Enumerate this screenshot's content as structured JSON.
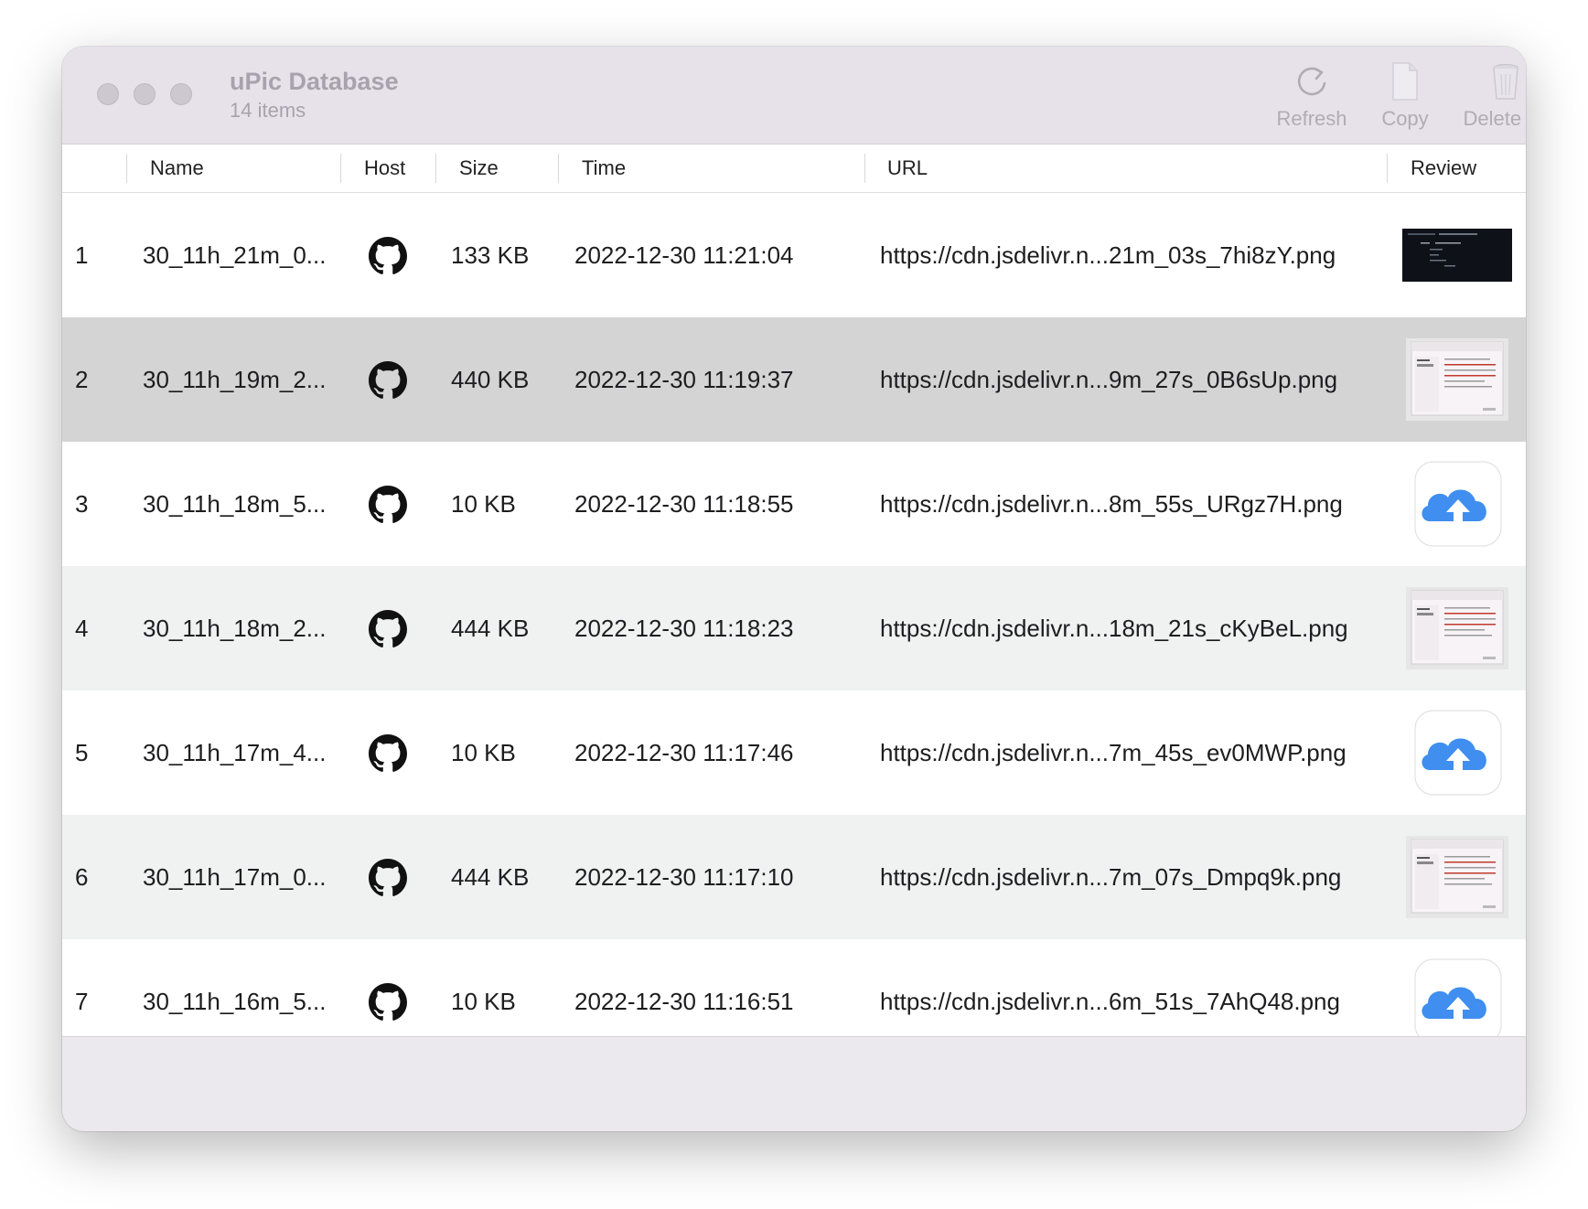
{
  "window": {
    "title": "uPic Database",
    "subtitle": "14 items"
  },
  "toolbar": {
    "refresh_label": "Refresh",
    "copy_label": "Copy",
    "delete_all_label": "Delete All"
  },
  "table": {
    "headers": {
      "index": "",
      "name": "Name",
      "host": "Host",
      "size": "Size",
      "time": "Time",
      "url": "URL",
      "review": "Review"
    },
    "rows": [
      {
        "index": "1",
        "name": "30_11h_21m_0...",
        "host_icon": "github-icon",
        "size": "133 KB",
        "time": "2022-12-30 11:21:04",
        "url": "https://cdn.jsdelivr.n...21m_03s_7hi8zY.png",
        "review": "dark-screenshot-thumbnail"
      },
      {
        "index": "2",
        "name": "30_11h_19m_2...",
        "host_icon": "github-icon",
        "size": "440 KB",
        "time": "2022-12-30 11:19:37",
        "url": "https://cdn.jsdelivr.n...9m_27s_0B6sUp.png",
        "review": "light-screenshot-thumbnail"
      },
      {
        "index": "3",
        "name": "30_11h_18m_5...",
        "host_icon": "github-icon",
        "size": "10 KB",
        "time": "2022-12-30 11:18:55",
        "url": "https://cdn.jsdelivr.n...8m_55s_URgz7H.png",
        "review": "upic-app-icon-thumbnail"
      },
      {
        "index": "4",
        "name": "30_11h_18m_2...",
        "host_icon": "github-icon",
        "size": "444 KB",
        "time": "2022-12-30 11:18:23",
        "url": "https://cdn.jsdelivr.n...18m_21s_cKyBeL.png",
        "review": "light-screenshot-thumbnail"
      },
      {
        "index": "5",
        "name": "30_11h_17m_4...",
        "host_icon": "github-icon",
        "size": "10 KB",
        "time": "2022-12-30 11:17:46",
        "url": "https://cdn.jsdelivr.n...7m_45s_ev0MWP.png",
        "review": "upic-app-icon-thumbnail"
      },
      {
        "index": "6",
        "name": "30_11h_17m_0...",
        "host_icon": "github-icon",
        "size": "444 KB",
        "time": "2022-12-30 11:17:10",
        "url": "https://cdn.jsdelivr.n...7m_07s_Dmpq9k.png",
        "review": "light-screenshot-thumbnail"
      },
      {
        "index": "7",
        "name": "30_11h_16m_5...",
        "host_icon": "github-icon",
        "size": "10 KB",
        "time": "2022-12-30 11:16:51",
        "url": "https://cdn.jsdelivr.n...6m_51s_7AhQ48.png",
        "review": "upic-app-icon-thumbnail"
      }
    ],
    "selected_row": 2
  },
  "colors": {
    "window_bg": "#ebe8ee",
    "row_selected": "#d4d4d4",
    "row_alt": "#f0f1f1",
    "row_plain": "#ffffff",
    "cloud_blue": "#3f8ef0",
    "toolbar_disabled": "#b1abb4"
  }
}
